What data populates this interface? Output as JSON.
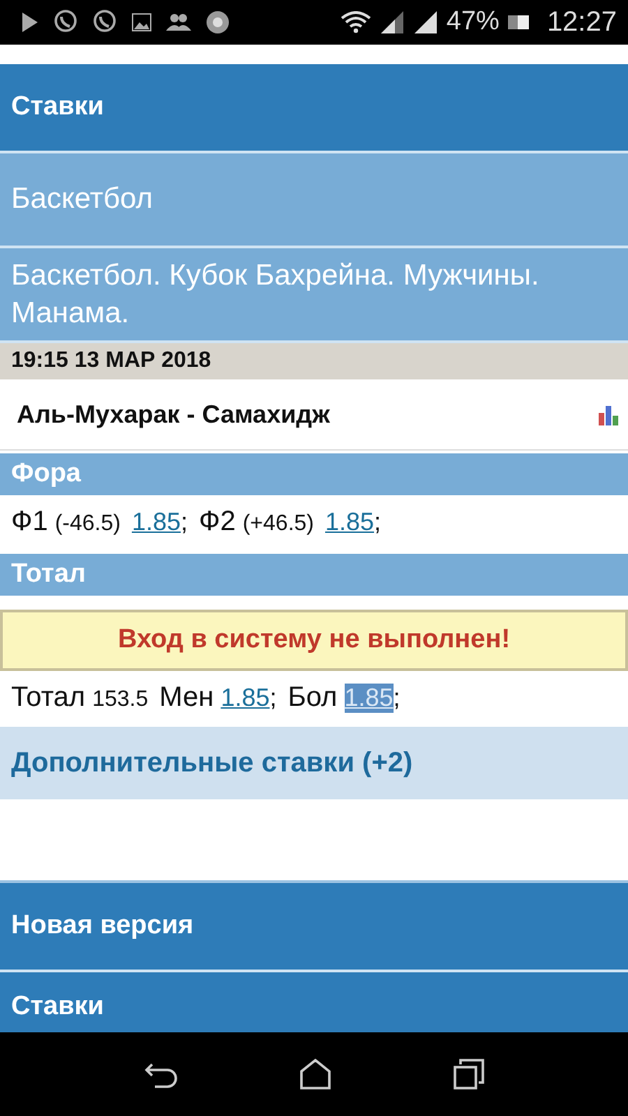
{
  "status_bar": {
    "battery": "47%",
    "time": "12:27"
  },
  "menu_top": [
    {
      "label": "Ставки",
      "kind": "primary"
    },
    {
      "label": "Баскетбол",
      "kind": "secondary"
    },
    {
      "label": "Баскетбол. Кубок Бахрейна. Мужчины. Манама.",
      "kind": "secondary"
    }
  ],
  "event": {
    "datetime": "19:15 13 МАР 2018",
    "match": "Аль-Мухарак - Самахидж"
  },
  "fora": {
    "title": "Фора",
    "items": [
      {
        "label": "Ф1",
        "value": "(-46.5)",
        "odds": "1.85",
        "suffix": ";",
        "selected": false
      },
      {
        "label": "Ф2",
        "value": "(+46.5)",
        "odds": "1.85",
        "suffix": ";",
        "selected": false
      }
    ]
  },
  "total": {
    "title": "Тотал",
    "error": "Вход в систему не выполнен!",
    "label": "Тотал",
    "value": "153.5",
    "items": [
      {
        "label": "Мен",
        "odds": "1.85",
        "suffix": ";",
        "selected": false
      },
      {
        "label": "Бол",
        "odds": "1.85",
        "suffix": ";",
        "selected": true
      }
    ]
  },
  "more_bets": "Дополнительные ставки (+2)",
  "menu_bottom": [
    {
      "label": "Новая версия",
      "kind": "primary"
    },
    {
      "label": "Ставки",
      "kind": "primary"
    }
  ]
}
